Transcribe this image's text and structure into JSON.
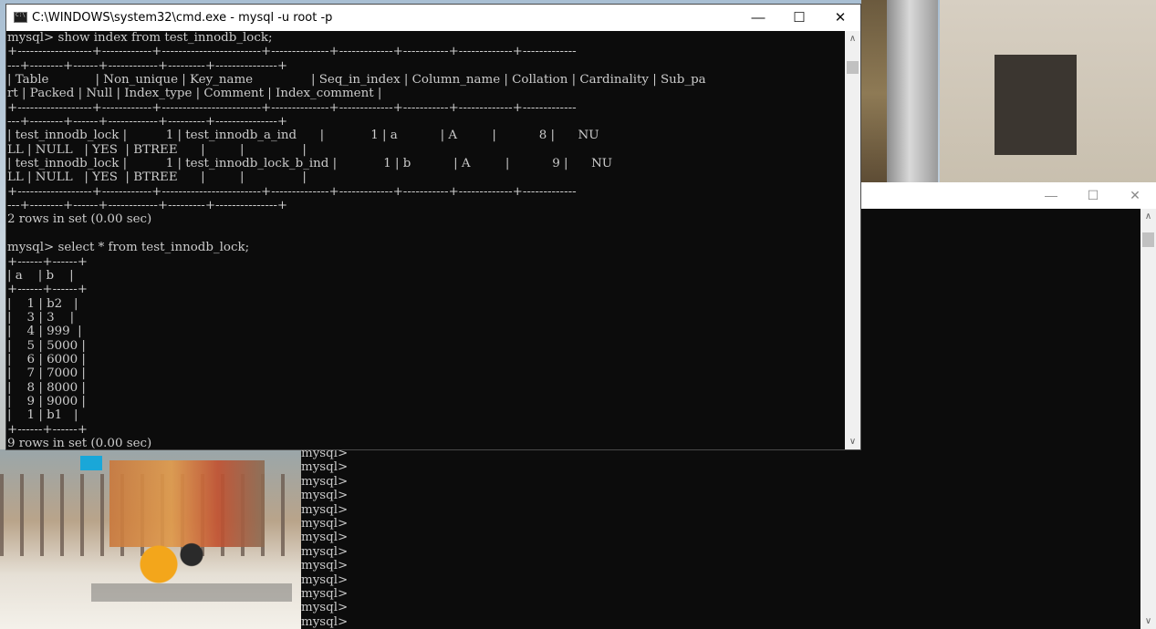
{
  "main_window": {
    "title": "C:\\WINDOWS\\system32\\cmd.exe - mysql  -u root -p",
    "minimize": "—",
    "maximize": "☐",
    "close": "✕",
    "console_lines": [
      "mysql> show index from test_innodb_lock;",
      "+------------------+------------+------------------------+--------------+-------------+-----------+-------------+-------------",
      "---+--------+------+------------+---------+---------------+",
      "| Table            | Non_unique | Key_name               | Seq_in_index | Column_name | Collation | Cardinality | Sub_pa",
      "rt | Packed | Null | Index_type | Comment | Index_comment |",
      "+------------------+------------+------------------------+--------------+-------------+-----------+-------------+-------------",
      "---+--------+------+------------+---------+---------------+",
      "| test_innodb_lock |          1 | test_innodb_a_ind      |            1 | a           | A         |           8 |      NU",
      "LL | NULL   | YES  | BTREE      |         |               |",
      "| test_innodb_lock |          1 | test_innodb_lock_b_ind |            1 | b           | A         |           9 |      NU",
      "LL | NULL   | YES  | BTREE      |         |               |",
      "+------------------+------------+------------------------+--------------+-------------+-----------+-------------+-------------",
      "---+--------+------+------------+---------+---------------+",
      "2 rows in set (0.00 sec)",
      "",
      "mysql> select * from test_innodb_lock;",
      "+------+------+",
      "| a    | b    |",
      "+------+------+",
      "|    1 | b2   |",
      "|    3 | 3    |",
      "|    4 | 999  |",
      "|    5 | 5000 |",
      "|    6 | 6000 |",
      "|    7 | 7000 |",
      "|    8 | 8000 |",
      "|    9 | 9000 |",
      "|    1 | b1   |",
      "+------+------+",
      "9 rows in set (0.00 sec)"
    ],
    "scroll_up": "∧",
    "scroll_down": "∨"
  },
  "background_window": {
    "minimize": "—",
    "maximize": "☐",
    "close": "✕",
    "scroll_up": "∧",
    "scroll_down": "∨",
    "console_lines": [
      "mysql>",
      "mysql>",
      "mysql>",
      "mysql>",
      "mysql>",
      "mysql>",
      "mysql>",
      "mysql>",
      "mysql>",
      "mysql>",
      "mysql>",
      "mysql>",
      "mysql>"
    ]
  },
  "colors": {
    "console_bg": "#0c0c0c",
    "console_text": "#cccccc",
    "titlebar_bg": "#ffffff"
  }
}
